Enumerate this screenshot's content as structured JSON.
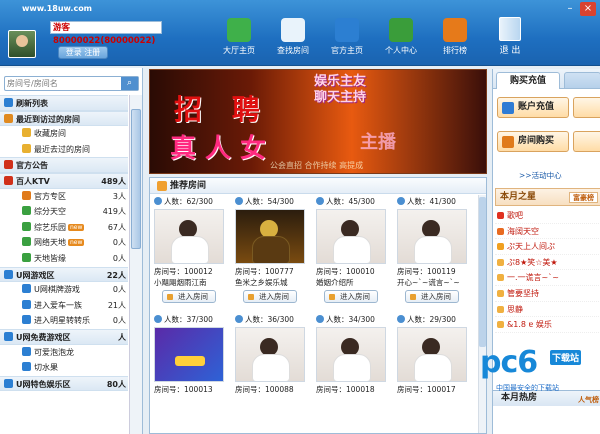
{
  "header": {
    "site": "www.18uw.com",
    "username": "游客80000022(80000022)",
    "auth_label": "登录 注册",
    "nav": [
      {
        "label": "大厅主页",
        "icon": "refresh-icon",
        "color": "#3fb04a"
      },
      {
        "label": "查找房间",
        "icon": "search-icon",
        "color": "#e9f3fb"
      },
      {
        "label": "官方主页",
        "icon": "home-icon",
        "color": "#2c7fd2"
      },
      {
        "label": "个人中心",
        "icon": "user-icon",
        "color": "#3a9d3a"
      },
      {
        "label": "排行榜",
        "icon": "chart-icon",
        "color": "#e67a1a"
      }
    ],
    "exit_label": "退 出"
  },
  "left": {
    "search_placeholder": "房间号/房间名",
    "tree": [
      {
        "label": "刷新列表",
        "bold": true,
        "count": "",
        "icon_color": "#2c7fd2"
      },
      {
        "label": "最近到访过的房间",
        "bold": true,
        "count": "",
        "icon_color": "#e08a20"
      },
      {
        "label": "收藏房间",
        "indent": 1,
        "count": "",
        "icon_color": "#e8b030"
      },
      {
        "label": "最近去过的房间",
        "indent": 1,
        "count": "",
        "icon_color": "#e8b030"
      },
      {
        "label": "官方公告",
        "bold": true,
        "count": "",
        "icon_color": "#d0301a"
      },
      {
        "label": "百人KTV",
        "bold": true,
        "count": "489人",
        "icon_color": "#d0301a"
      },
      {
        "label": "官方专区",
        "indent": 1,
        "count": "3人",
        "icon_color": "#e07a1a"
      },
      {
        "label": "综分天空",
        "indent": 1,
        "count": "419人",
        "icon_color": "#3aa040"
      },
      {
        "label": "综艺乐园",
        "indent": 1,
        "count": "67人",
        "icon_color": "#3aa040",
        "tag": "new"
      },
      {
        "label": "网络天地",
        "indent": 1,
        "count": "0人",
        "icon_color": "#3aa040",
        "tag": "new"
      },
      {
        "label": "天地皆缘",
        "indent": 1,
        "count": "0人",
        "icon_color": "#3aa040"
      },
      {
        "label": "U网游戏区",
        "bold": true,
        "count": "22人",
        "icon_color": "#2c7fd2"
      },
      {
        "label": "U网棋牌游戏",
        "indent": 1,
        "count": "0人",
        "icon_color": "#2c7fd2"
      },
      {
        "label": "进入爱车一族",
        "indent": 1,
        "count": "21人",
        "icon_color": "#2c7fd2"
      },
      {
        "label": "进入明星转转乐",
        "indent": 1,
        "count": "0人",
        "icon_color": "#2c7fd2"
      },
      {
        "label": "U网免费游戏区",
        "bold": true,
        "count": "人",
        "icon_color": "#2c7fd2"
      },
      {
        "label": "可爱泡泡龙",
        "indent": 1,
        "count": "",
        "icon_color": "#2c7fd2"
      },
      {
        "label": "切水果",
        "indent": 1,
        "count": "",
        "icon_color": "#2c7fd2"
      },
      {
        "label": "U网特色娱乐区",
        "bold": true,
        "count": "80人",
        "icon_color": "#2c7fd2"
      }
    ]
  },
  "banner": {
    "line1": "招 聘",
    "line2a": "娱乐主友",
    "line2b": "聊天主持",
    "line3": "真人女",
    "line4": "主播",
    "small": "公会直招 合作持续 高提成"
  },
  "rooms": {
    "title": "推荐房间",
    "enter_label": "进入房间",
    "cards": [
      {
        "users": "人数：62/300",
        "rid": "房间号：100012",
        "name": "小飓飓烟雨江南",
        "photo": "light"
      },
      {
        "users": "人数：54/300",
        "rid": "房间号：100777",
        "name": "鱼米之乡娱乐城",
        "photo": "dark"
      },
      {
        "users": "人数：45/300",
        "rid": "房间号：100010",
        "name": "婚姻介绍所",
        "photo": "light"
      },
      {
        "users": "人数：41/300",
        "rid": "房间号：100119",
        "name": "开心~`~谎言~`~",
        "photo": "light"
      },
      {
        "users": "人数：37/300",
        "rid": "房间号：100013",
        "name": "",
        "photo": "purple"
      },
      {
        "users": "人数：36/300",
        "rid": "房间号：100088",
        "name": "",
        "photo": "light"
      },
      {
        "users": "人数：34/300",
        "rid": "房间号：100018",
        "name": "",
        "photo": "light"
      },
      {
        "users": "人数：29/300",
        "rid": "房间号：100017",
        "name": "",
        "photo": "light"
      }
    ]
  },
  "right": {
    "tab": "购买充值",
    "buy1": "账户充值",
    "buy2": "房间购买",
    "activity": ">>活动中心",
    "stars_title": "本月之星",
    "rich_label": "富豪榜",
    "stars": [
      "歌吧",
      "海阔天空",
      "ぷ天上人间ぷ",
      "ぷ8★笑☆美★",
      "一.一谎言~`~",
      "管要坚持",
      "思静",
      "&1.8 ɐ 娱乐"
    ],
    "hot_title": "本月热房",
    "popularity": "人气榜"
  },
  "watermark": {
    "brand": "pc6",
    "tag": "下载站",
    "sub": "中国最安全的下载站"
  }
}
